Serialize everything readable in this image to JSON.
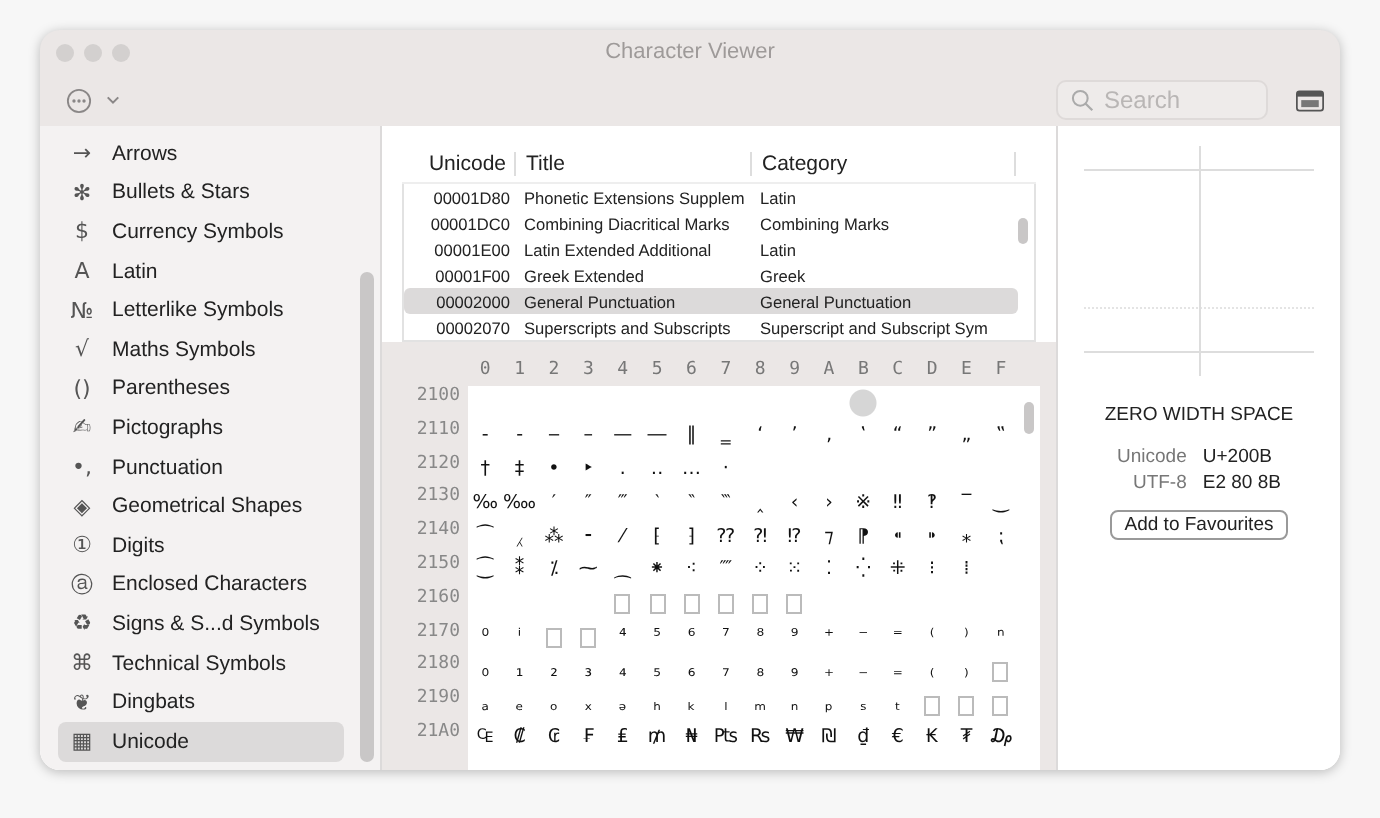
{
  "window": {
    "title": "Character Viewer"
  },
  "toolbar": {
    "search": {
      "placeholder": "Search"
    }
  },
  "sidebar": {
    "items": [
      {
        "icon": "→",
        "label": "Arrows",
        "selected": false
      },
      {
        "icon": "✻",
        "label": "Bullets & Stars",
        "selected": false
      },
      {
        "icon": "$",
        "label": "Currency Symbols",
        "selected": false
      },
      {
        "icon": "A",
        "label": "Latin",
        "selected": false
      },
      {
        "icon": "№",
        "label": "Letterlike Symbols",
        "selected": false
      },
      {
        "icon": "√",
        "label": "Maths Symbols",
        "selected": false
      },
      {
        "icon": "()",
        "label": "Parentheses",
        "selected": false
      },
      {
        "icon": "✍",
        "label": "Pictographs",
        "selected": false
      },
      {
        "icon": "•,",
        "label": "Punctuation",
        "selected": false
      },
      {
        "icon": "◈",
        "label": "Geometrical Shapes",
        "selected": false
      },
      {
        "icon": "①",
        "label": "Digits",
        "selected": false
      },
      {
        "icon": "ⓐ",
        "label": "Enclosed Characters",
        "selected": false
      },
      {
        "icon": "♻",
        "label": "Signs & S...d Symbols",
        "selected": false
      },
      {
        "icon": "⌘",
        "label": "Technical Symbols",
        "selected": false
      },
      {
        "icon": "❦",
        "label": "Dingbats",
        "selected": false
      },
      {
        "icon": "▦",
        "label": "Unicode",
        "selected": true
      }
    ]
  },
  "blocks_table": {
    "columns": [
      "Unicode",
      "Title",
      "Category"
    ],
    "rows": [
      {
        "unicode": "00001D80",
        "title": "Phonetic Extensions Supplem",
        "category": "Latin",
        "selected": false
      },
      {
        "unicode": "00001DC0",
        "title": "Combining Diacritical Marks",
        "category": "Combining Marks",
        "selected": false
      },
      {
        "unicode": "00001E00",
        "title": "Latin Extended Additional",
        "category": "Latin",
        "selected": false
      },
      {
        "unicode": "00001F00",
        "title": "Greek Extended",
        "category": "Greek",
        "selected": false
      },
      {
        "unicode": "00002000",
        "title": "General Punctuation",
        "category": "General Punctuation",
        "selected": true
      },
      {
        "unicode": "00002070",
        "title": "Superscripts and Subscripts",
        "category": "Superscript and Subscript Sym",
        "selected": false
      }
    ]
  },
  "char_grid": {
    "columns": [
      "0",
      "1",
      "2",
      "3",
      "4",
      "5",
      "6",
      "7",
      "8",
      "9",
      "A",
      "B",
      "C",
      "D",
      "E",
      "F"
    ],
    "rows": [
      {
        "label": "2100",
        "cells": [
          {
            "kind": "blank",
            "selected": false
          },
          {
            "kind": "blank",
            "selected": false
          },
          {
            "kind": "blank",
            "selected": false
          },
          {
            "kind": "blank",
            "selected": false
          },
          {
            "kind": "blank",
            "selected": false
          },
          {
            "kind": "blank",
            "selected": false
          },
          {
            "kind": "blank",
            "selected": false
          },
          {
            "kind": "blank",
            "selected": false
          },
          {
            "kind": "blank",
            "selected": false
          },
          {
            "kind": "blank",
            "selected": false
          },
          {
            "kind": "blank",
            "selected": false
          },
          {
            "kind": "blank",
            "selected": true
          },
          {
            "kind": "blank",
            "selected": false
          },
          {
            "kind": "blank",
            "selected": false
          },
          {
            "kind": "blank",
            "selected": false
          },
          {
            "kind": "blank",
            "selected": false
          }
        ]
      },
      {
        "label": "2110",
        "cells": [
          {
            "kind": "glyph",
            "c": "‐",
            "selected": false
          },
          {
            "kind": "glyph",
            "c": "‑",
            "selected": false
          },
          {
            "kind": "glyph",
            "c": "‒",
            "selected": false
          },
          {
            "kind": "glyph",
            "c": "–",
            "selected": false
          },
          {
            "kind": "glyph",
            "c": "—",
            "selected": false
          },
          {
            "kind": "glyph",
            "c": "―",
            "selected": false
          },
          {
            "kind": "glyph",
            "c": "‖",
            "selected": false
          },
          {
            "kind": "glyph",
            "c": "‗",
            "selected": false
          },
          {
            "kind": "glyph",
            "c": "‘",
            "selected": false
          },
          {
            "kind": "glyph",
            "c": "’",
            "selected": false
          },
          {
            "kind": "glyph",
            "c": "‚",
            "selected": false
          },
          {
            "kind": "glyph",
            "c": "‛",
            "selected": false
          },
          {
            "kind": "glyph",
            "c": "“",
            "selected": false
          },
          {
            "kind": "glyph",
            "c": "”",
            "selected": false
          },
          {
            "kind": "glyph",
            "c": "„",
            "selected": false
          },
          {
            "kind": "glyph",
            "c": "‟",
            "selected": false
          }
        ]
      },
      {
        "label": "2120",
        "cells": [
          {
            "kind": "glyph",
            "c": "†",
            "selected": false
          },
          {
            "kind": "glyph",
            "c": "‡",
            "selected": false
          },
          {
            "kind": "glyph",
            "c": "•",
            "selected": false
          },
          {
            "kind": "glyph",
            "c": "‣",
            "selected": false
          },
          {
            "kind": "glyph",
            "c": "․",
            "selected": false
          },
          {
            "kind": "glyph",
            "c": "‥",
            "selected": false
          },
          {
            "kind": "glyph",
            "c": "…",
            "selected": false
          },
          {
            "kind": "glyph",
            "c": "‧",
            "selected": false
          },
          {
            "kind": "blank",
            "selected": false
          },
          {
            "kind": "blank",
            "selected": false
          },
          {
            "kind": "blank",
            "selected": false
          },
          {
            "kind": "blank",
            "selected": false
          },
          {
            "kind": "blank",
            "selected": false
          },
          {
            "kind": "blank",
            "selected": false
          },
          {
            "kind": "blank",
            "selected": false
          },
          {
            "kind": "blank",
            "selected": false
          }
        ]
      },
      {
        "label": "2130",
        "cells": [
          {
            "kind": "glyph",
            "c": "‰",
            "selected": false
          },
          {
            "kind": "glyph",
            "c": "‱",
            "selected": false
          },
          {
            "kind": "glyph",
            "c": "′",
            "selected": false
          },
          {
            "kind": "glyph",
            "c": "″",
            "selected": false
          },
          {
            "kind": "glyph",
            "c": "‴",
            "selected": false
          },
          {
            "kind": "glyph",
            "c": "‵",
            "selected": false
          },
          {
            "kind": "glyph",
            "c": "‶",
            "selected": false
          },
          {
            "kind": "glyph",
            "c": "‷",
            "selected": false
          },
          {
            "kind": "glyph",
            "c": "‸",
            "selected": false
          },
          {
            "kind": "glyph",
            "c": "‹",
            "selected": false
          },
          {
            "kind": "glyph",
            "c": "›",
            "selected": false
          },
          {
            "kind": "glyph",
            "c": "※",
            "selected": false
          },
          {
            "kind": "glyph",
            "c": "‼",
            "selected": false
          },
          {
            "kind": "glyph",
            "c": "‽",
            "selected": false
          },
          {
            "kind": "glyph",
            "c": "‾",
            "selected": false
          },
          {
            "kind": "glyph",
            "c": "‿",
            "selected": false
          }
        ]
      },
      {
        "label": "2140",
        "cells": [
          {
            "kind": "glyph",
            "c": "⁀",
            "selected": false
          },
          {
            "kind": "glyph",
            "c": "⁁",
            "selected": false
          },
          {
            "kind": "glyph",
            "c": "⁂",
            "selected": false
          },
          {
            "kind": "glyph",
            "c": "⁃",
            "selected": false
          },
          {
            "kind": "glyph",
            "c": "⁄",
            "selected": false
          },
          {
            "kind": "glyph",
            "c": "⁅",
            "selected": false
          },
          {
            "kind": "glyph",
            "c": "⁆",
            "selected": false
          },
          {
            "kind": "glyph",
            "c": "⁇",
            "selected": false
          },
          {
            "kind": "glyph",
            "c": "⁈",
            "selected": false
          },
          {
            "kind": "glyph",
            "c": "⁉",
            "selected": false
          },
          {
            "kind": "glyph",
            "c": "⁊",
            "selected": false
          },
          {
            "kind": "glyph",
            "c": "⁋",
            "selected": false
          },
          {
            "kind": "glyph",
            "c": "⁌",
            "selected": false
          },
          {
            "kind": "glyph",
            "c": "⁍",
            "selected": false
          },
          {
            "kind": "glyph",
            "c": "⁎",
            "selected": false
          },
          {
            "kind": "glyph",
            "c": "⁏",
            "selected": false
          }
        ]
      },
      {
        "label": "2150",
        "cells": [
          {
            "kind": "glyph",
            "c": "⁐",
            "selected": false
          },
          {
            "kind": "glyph",
            "c": "⁑",
            "selected": false
          },
          {
            "kind": "glyph",
            "c": "⁒",
            "selected": false
          },
          {
            "kind": "glyph",
            "c": "⁓",
            "selected": false
          },
          {
            "kind": "glyph",
            "c": "⁔",
            "selected": false
          },
          {
            "kind": "glyph",
            "c": "⁕",
            "selected": false
          },
          {
            "kind": "glyph",
            "c": "⁖",
            "selected": false
          },
          {
            "kind": "glyph",
            "c": "⁗",
            "selected": false
          },
          {
            "kind": "glyph",
            "c": "⁘",
            "selected": false
          },
          {
            "kind": "glyph",
            "c": "⁙",
            "selected": false
          },
          {
            "kind": "glyph",
            "c": "⁚",
            "selected": false
          },
          {
            "kind": "glyph",
            "c": "⁛",
            "selected": false
          },
          {
            "kind": "glyph",
            "c": "⁜",
            "selected": false
          },
          {
            "kind": "glyph",
            "c": "⁝",
            "selected": false
          },
          {
            "kind": "glyph",
            "c": "⁞",
            "selected": false
          },
          {
            "kind": "blank",
            "selected": false
          }
        ]
      },
      {
        "label": "2160",
        "cells": [
          {
            "kind": "blank",
            "selected": false
          },
          {
            "kind": "blank",
            "selected": false
          },
          {
            "kind": "blank",
            "selected": false
          },
          {
            "kind": "blank",
            "selected": false
          },
          {
            "kind": "missing",
            "selected": false
          },
          {
            "kind": "missing",
            "selected": false
          },
          {
            "kind": "missing",
            "selected": false
          },
          {
            "kind": "missing",
            "selected": false
          },
          {
            "kind": "missing",
            "selected": false
          },
          {
            "kind": "missing",
            "selected": false
          },
          {
            "kind": "blank",
            "selected": false
          },
          {
            "kind": "blank",
            "selected": false
          },
          {
            "kind": "blank",
            "selected": false
          },
          {
            "kind": "blank",
            "selected": false
          },
          {
            "kind": "blank",
            "selected": false
          },
          {
            "kind": "blank",
            "selected": false
          }
        ]
      },
      {
        "label": "2170",
        "cells": [
          {
            "kind": "glyph",
            "c": "⁰",
            "selected": false
          },
          {
            "kind": "glyph",
            "c": "ⁱ",
            "selected": false
          },
          {
            "kind": "missing",
            "selected": false
          },
          {
            "kind": "missing",
            "selected": false
          },
          {
            "kind": "glyph",
            "c": "⁴",
            "selected": false
          },
          {
            "kind": "glyph",
            "c": "⁵",
            "selected": false
          },
          {
            "kind": "glyph",
            "c": "⁶",
            "selected": false
          },
          {
            "kind": "glyph",
            "c": "⁷",
            "selected": false
          },
          {
            "kind": "glyph",
            "c": "⁸",
            "selected": false
          },
          {
            "kind": "glyph",
            "c": "⁹",
            "selected": false
          },
          {
            "kind": "glyph",
            "c": "⁺",
            "selected": false
          },
          {
            "kind": "glyph",
            "c": "⁻",
            "selected": false
          },
          {
            "kind": "glyph",
            "c": "⁼",
            "selected": false
          },
          {
            "kind": "glyph",
            "c": "⁽",
            "selected": false
          },
          {
            "kind": "glyph",
            "c": "⁾",
            "selected": false
          },
          {
            "kind": "glyph",
            "c": "ⁿ",
            "selected": false
          }
        ]
      },
      {
        "label": "2180",
        "cells": [
          {
            "kind": "glyph",
            "c": "₀",
            "selected": false
          },
          {
            "kind": "glyph",
            "c": "₁",
            "selected": false
          },
          {
            "kind": "glyph",
            "c": "₂",
            "selected": false
          },
          {
            "kind": "glyph",
            "c": "₃",
            "selected": false
          },
          {
            "kind": "glyph",
            "c": "₄",
            "selected": false
          },
          {
            "kind": "glyph",
            "c": "₅",
            "selected": false
          },
          {
            "kind": "glyph",
            "c": "₆",
            "selected": false
          },
          {
            "kind": "glyph",
            "c": "₇",
            "selected": false
          },
          {
            "kind": "glyph",
            "c": "₈",
            "selected": false
          },
          {
            "kind": "glyph",
            "c": "₉",
            "selected": false
          },
          {
            "kind": "glyph",
            "c": "₊",
            "selected": false
          },
          {
            "kind": "glyph",
            "c": "₋",
            "selected": false
          },
          {
            "kind": "glyph",
            "c": "₌",
            "selected": false
          },
          {
            "kind": "glyph",
            "c": "₍",
            "selected": false
          },
          {
            "kind": "glyph",
            "c": "₎",
            "selected": false
          },
          {
            "kind": "missing",
            "selected": false
          }
        ]
      },
      {
        "label": "2190",
        "cells": [
          {
            "kind": "glyph",
            "c": "ₐ",
            "selected": false
          },
          {
            "kind": "glyph",
            "c": "ₑ",
            "selected": false
          },
          {
            "kind": "glyph",
            "c": "ₒ",
            "selected": false
          },
          {
            "kind": "glyph",
            "c": "ₓ",
            "selected": false
          },
          {
            "kind": "glyph",
            "c": "ₔ",
            "selected": false
          },
          {
            "kind": "glyph",
            "c": "ₕ",
            "selected": false
          },
          {
            "kind": "glyph",
            "c": "ₖ",
            "selected": false
          },
          {
            "kind": "glyph",
            "c": "ₗ",
            "selected": false
          },
          {
            "kind": "glyph",
            "c": "ₘ",
            "selected": false
          },
          {
            "kind": "glyph",
            "c": "ₙ",
            "selected": false
          },
          {
            "kind": "glyph",
            "c": "ₚ",
            "selected": false
          },
          {
            "kind": "glyph",
            "c": "ₛ",
            "selected": false
          },
          {
            "kind": "glyph",
            "c": "ₜ",
            "selected": false
          },
          {
            "kind": "missing",
            "selected": false
          },
          {
            "kind": "missing",
            "selected": false
          },
          {
            "kind": "missing",
            "selected": false
          }
        ]
      },
      {
        "label": "21A0",
        "cells": [
          {
            "kind": "glyph",
            "c": "₠",
            "selected": false
          },
          {
            "kind": "glyph",
            "c": "₡",
            "selected": false
          },
          {
            "kind": "glyph",
            "c": "₢",
            "selected": false
          },
          {
            "kind": "glyph",
            "c": "₣",
            "selected": false
          },
          {
            "kind": "glyph",
            "c": "₤",
            "selected": false
          },
          {
            "kind": "glyph",
            "c": "₥",
            "selected": false
          },
          {
            "kind": "glyph",
            "c": "₦",
            "selected": false
          },
          {
            "kind": "glyph",
            "c": "₧",
            "selected": false
          },
          {
            "kind": "glyph",
            "c": "₨",
            "selected": false
          },
          {
            "kind": "glyph",
            "c": "₩",
            "selected": false
          },
          {
            "kind": "glyph",
            "c": "₪",
            "selected": false
          },
          {
            "kind": "glyph",
            "c": "₫",
            "selected": false
          },
          {
            "kind": "glyph",
            "c": "€",
            "selected": false
          },
          {
            "kind": "glyph",
            "c": "₭",
            "selected": false
          },
          {
            "kind": "glyph",
            "c": "₮",
            "selected": false
          },
          {
            "kind": "glyph",
            "c": "₯",
            "selected": false
          }
        ]
      }
    ]
  },
  "detail": {
    "name": "ZERO WIDTH SPACE",
    "fields": [
      {
        "label": "Unicode",
        "value": "U+200B"
      },
      {
        "label": "UTF-8",
        "value": "E2 80 8B"
      }
    ],
    "button": "Add to Favourites"
  }
}
